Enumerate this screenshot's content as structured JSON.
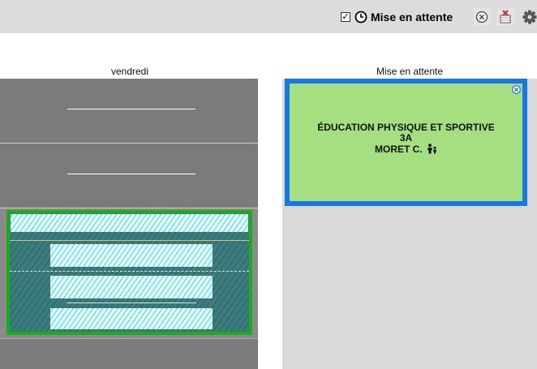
{
  "toolbar": {
    "checkbox_checked": true,
    "checkbox_label": "Mise en attente",
    "icons": [
      "clock-icon",
      "close-circle-icon",
      "calendar-delete-icon",
      "gear-icon"
    ]
  },
  "columns": {
    "day_title": "vendredi",
    "waiting_title": "Mise en attente"
  },
  "waiting_card": {
    "subject": "ÉDUCATION PHYSIQUE ET SPORTIVE",
    "class": "3A",
    "teacher": "MORET C.",
    "bg_color": "#a6df80",
    "border_color": "#1677e6"
  },
  "course": {
    "border_color": "#16b116",
    "hatch_color": "#37d8e0"
  }
}
